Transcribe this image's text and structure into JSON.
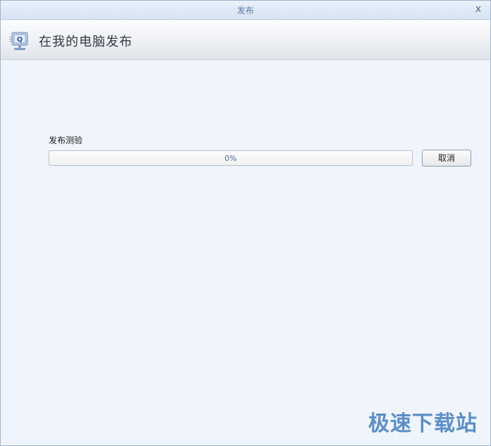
{
  "window": {
    "title": "发布",
    "close_glyph": "x"
  },
  "header": {
    "title": "在我的电脑发布",
    "icon": "publish-computer-icon"
  },
  "task": {
    "label": "发布测验",
    "progress_text": "0%",
    "progress_value": 0
  },
  "buttons": {
    "cancel_label": "取消"
  },
  "watermark": {
    "text": "极速下载站"
  },
  "colors": {
    "title_text": "#5a7aa5",
    "accent": "#5b8fc7",
    "background": "#f0f5fd"
  }
}
